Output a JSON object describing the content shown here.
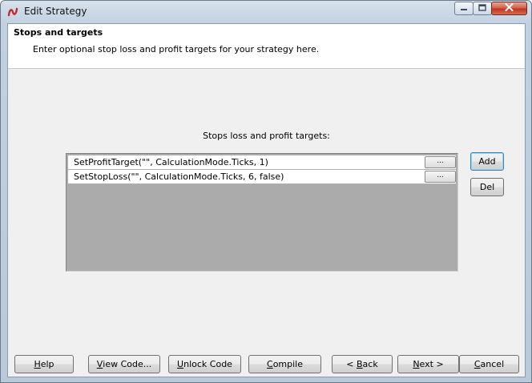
{
  "window": {
    "title": "Edit Strategy"
  },
  "header": {
    "title": "Stops and targets",
    "subtitle": "Enter optional stop loss and profit targets for your strategy here."
  },
  "targets": {
    "label": "Stops loss and profit targets:",
    "rows": [
      {
        "text": "SetProfitTarget(\"\", CalculationMode.Ticks, 1)",
        "button": "..."
      },
      {
        "text": "SetStopLoss(\"\", CalculationMode.Ticks, 6, false)",
        "button": "..."
      }
    ],
    "add_label": "Add",
    "del_label": "Del"
  },
  "footer": {
    "help": {
      "u": "H",
      "rest": "elp"
    },
    "view_code": {
      "pre": "",
      "u": "V",
      "rest": "iew Code..."
    },
    "unlock_code": {
      "pre": "",
      "u": "U",
      "rest": "nlock Code"
    },
    "compile": {
      "pre": "",
      "u": "C",
      "rest": "ompile"
    },
    "back": {
      "pre": "< ",
      "u": "B",
      "rest": "ack"
    },
    "next": {
      "pre": "",
      "u": "N",
      "rest": "ext >"
    },
    "cancel": {
      "pre": "",
      "u": "C",
      "rest": "ancel"
    }
  },
  "colors": {
    "grid_background": "#ababab",
    "close_button": "#c8432b"
  }
}
